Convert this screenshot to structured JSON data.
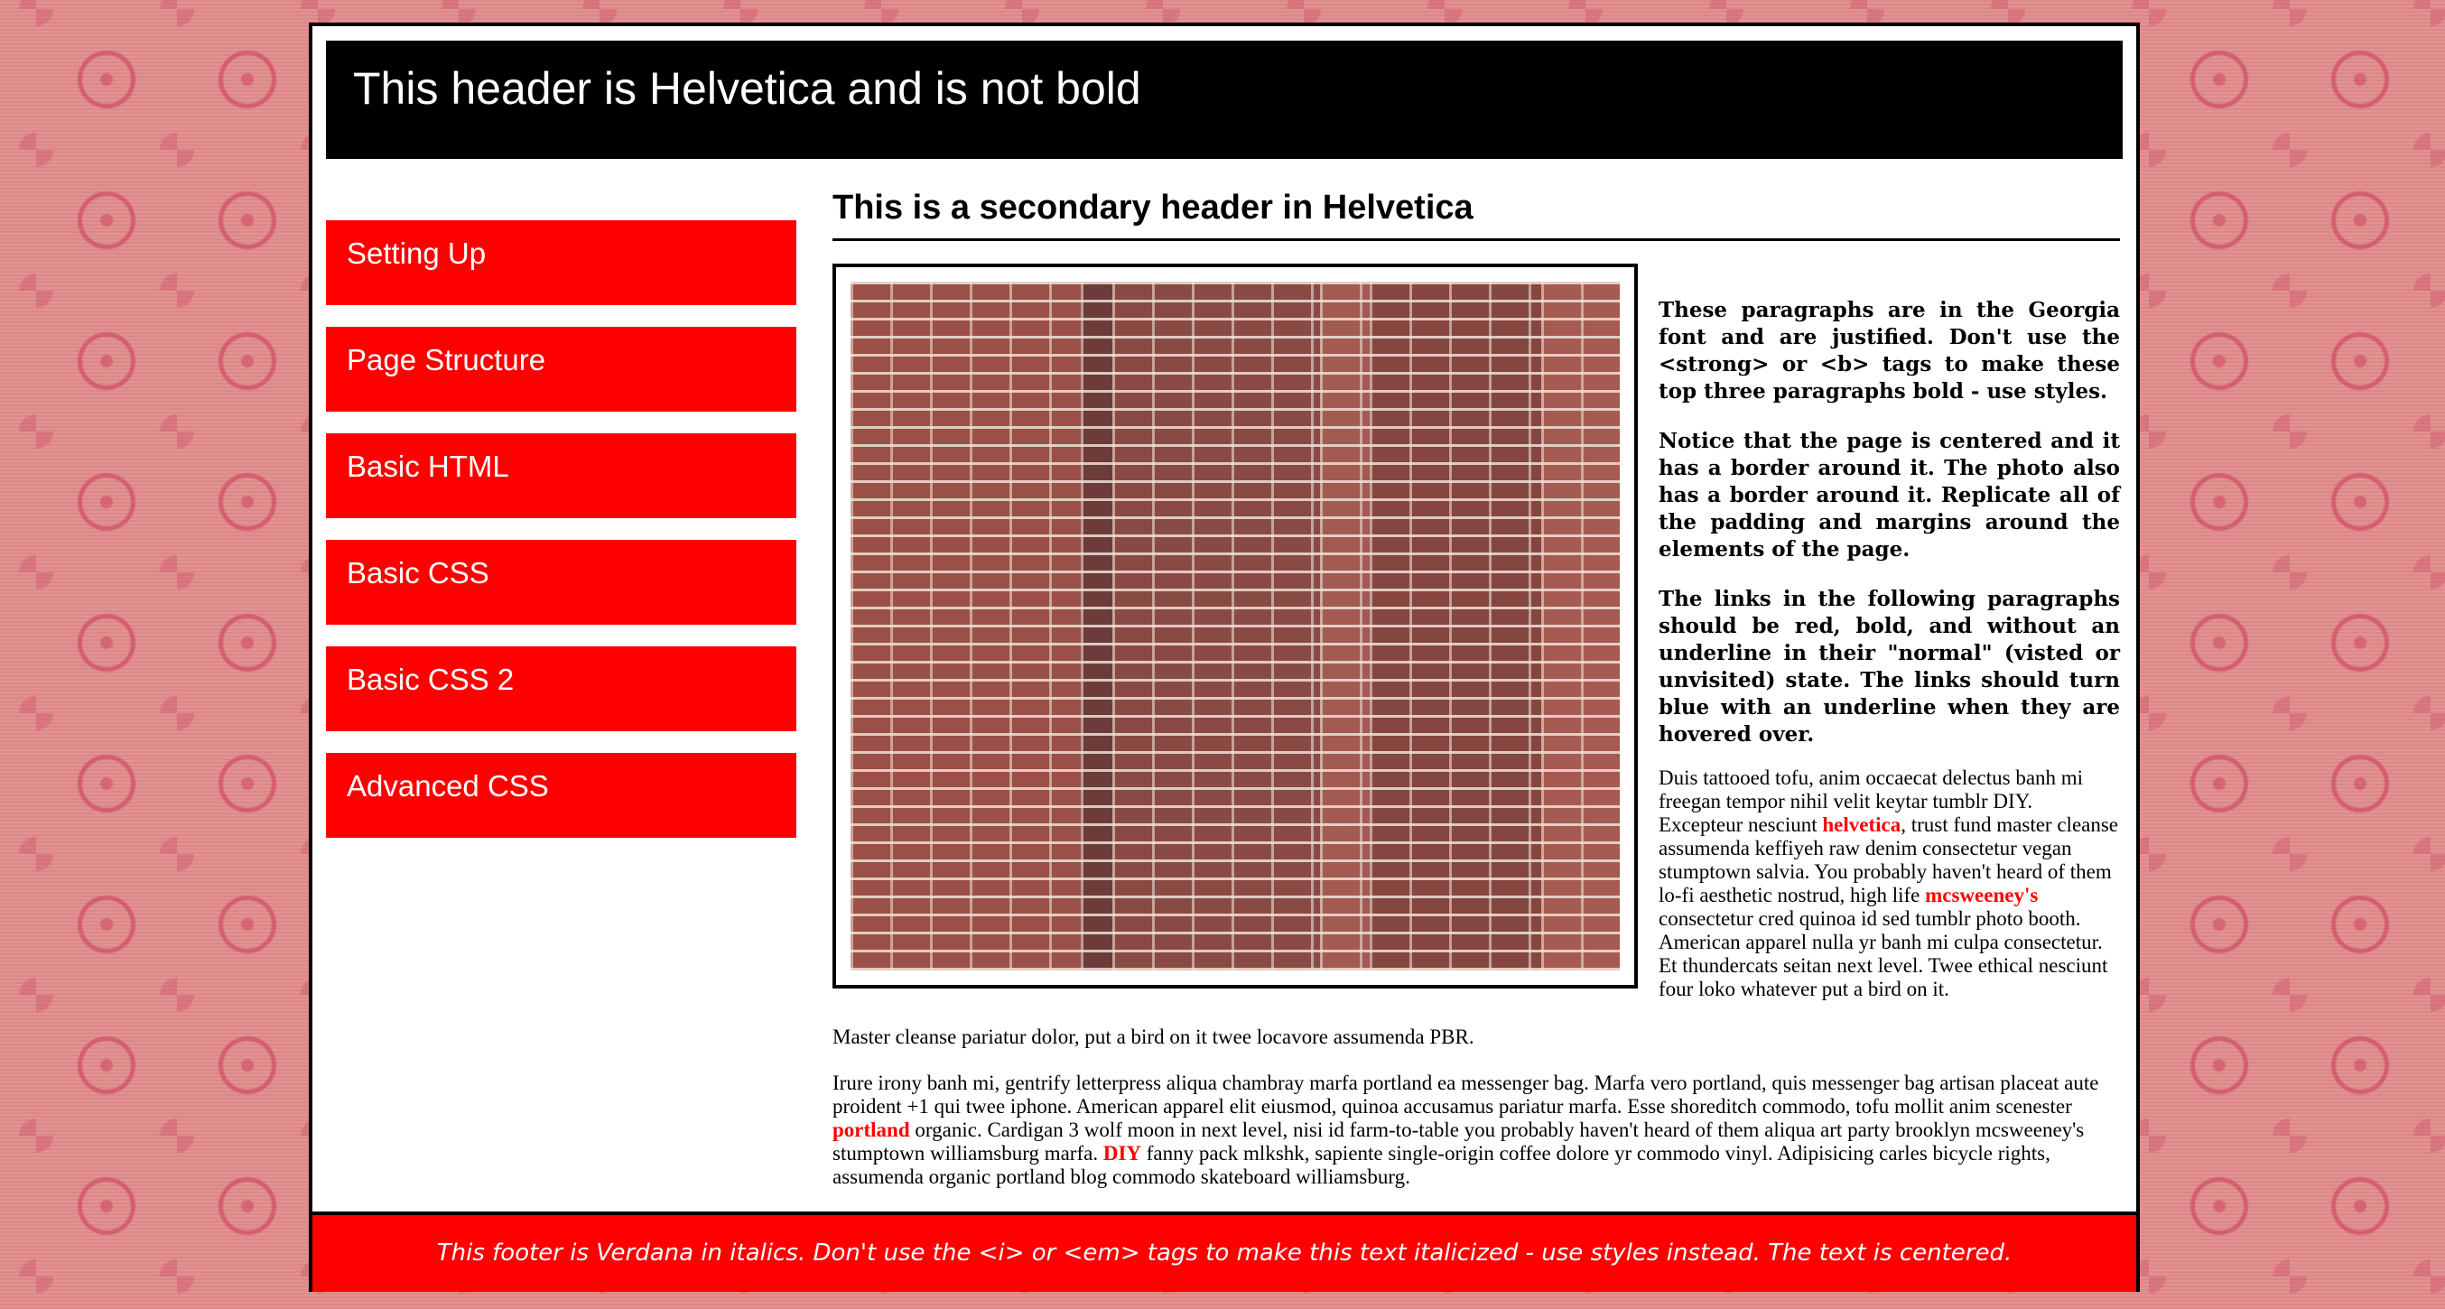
{
  "header": {
    "title": "This header is Helvetica and is not bold"
  },
  "sidebar": {
    "items": [
      {
        "label": "Setting Up"
      },
      {
        "label": "Page Structure"
      },
      {
        "label": "Basic HTML"
      },
      {
        "label": "Basic CSS"
      },
      {
        "label": "Basic CSS 2"
      },
      {
        "label": "Advanced CSS"
      }
    ]
  },
  "main": {
    "title": "This is a secondary header in Helvetica",
    "intro": [
      "These paragraphs are in the Georgia font and are justified. Don't use the <strong> or <b> tags to make these top three paragraphs bold - use styles.",
      "Notice that the page is centered and it has a border around it. The photo also has a border around it. Replicate all of the padding and margins around the elements of the page.",
      "The links in the following paragraphs should be red, bold, and without an underline in their \"normal\" (visted or unvisited) state. The links should turn blue with an underline when they are hovered over."
    ],
    "paragraph1": {
      "part1": "Duis tattooed tofu, anim occaecat delectus banh mi freegan tempor nihil velit keytar tumblr DIY. Excepteur nesciunt ",
      "link1": "helvetica",
      "part2": ", trust fund master cleanse assumenda keffiyeh raw denim consectetur vegan stumptown salvia. You probably haven't heard of them lo-fi aesthetic nostrud, high life ",
      "link2": "mcsweeney's",
      "part3": " consectetur cred quinoa id sed tumblr photo booth. American apparel nulla yr banh mi culpa consectetur. Et thundercats seitan next level. Twee ethical nesciunt four loko whatever put a bird on it.",
      "tail": "Master cleanse pariatur dolor, put a bird on it twee locavore assumenda PBR."
    },
    "paragraph2": {
      "part1": "Irure irony banh mi, gentrify letterpress aliqua chambray marfa portland ea messenger bag. Marfa vero portland, quis messenger bag artisan placeat aute proident +1 qui twee iphone. American apparel elit eiusmod, quinoa accusamus pariatur marfa. Esse shoreditch commodo, tofu mollit anim scenester ",
      "link1": "portland",
      "part2": " organic. Cardigan 3 wolf moon in next level, nisi id farm-to-table you probably haven't heard of them aliqua art party brooklyn mcsweeney's stumptown williamsburg marfa. ",
      "link2": "DIY",
      "part3": " fanny pack mlkshk, sapiente single-origin coffee dolore yr commodo vinyl. Adipisicing carles bicycle rights, assumenda organic portland blog commodo skateboard williamsburg."
    }
  },
  "footer": {
    "text": "This footer is Verdana in italics. Don't use the <i> or <em> tags to make this text italicized - use styles instead. The text is centered."
  },
  "colors": {
    "accent": "#ff0000",
    "header_bg": "#000000",
    "page_bg": "#e08b8b"
  }
}
